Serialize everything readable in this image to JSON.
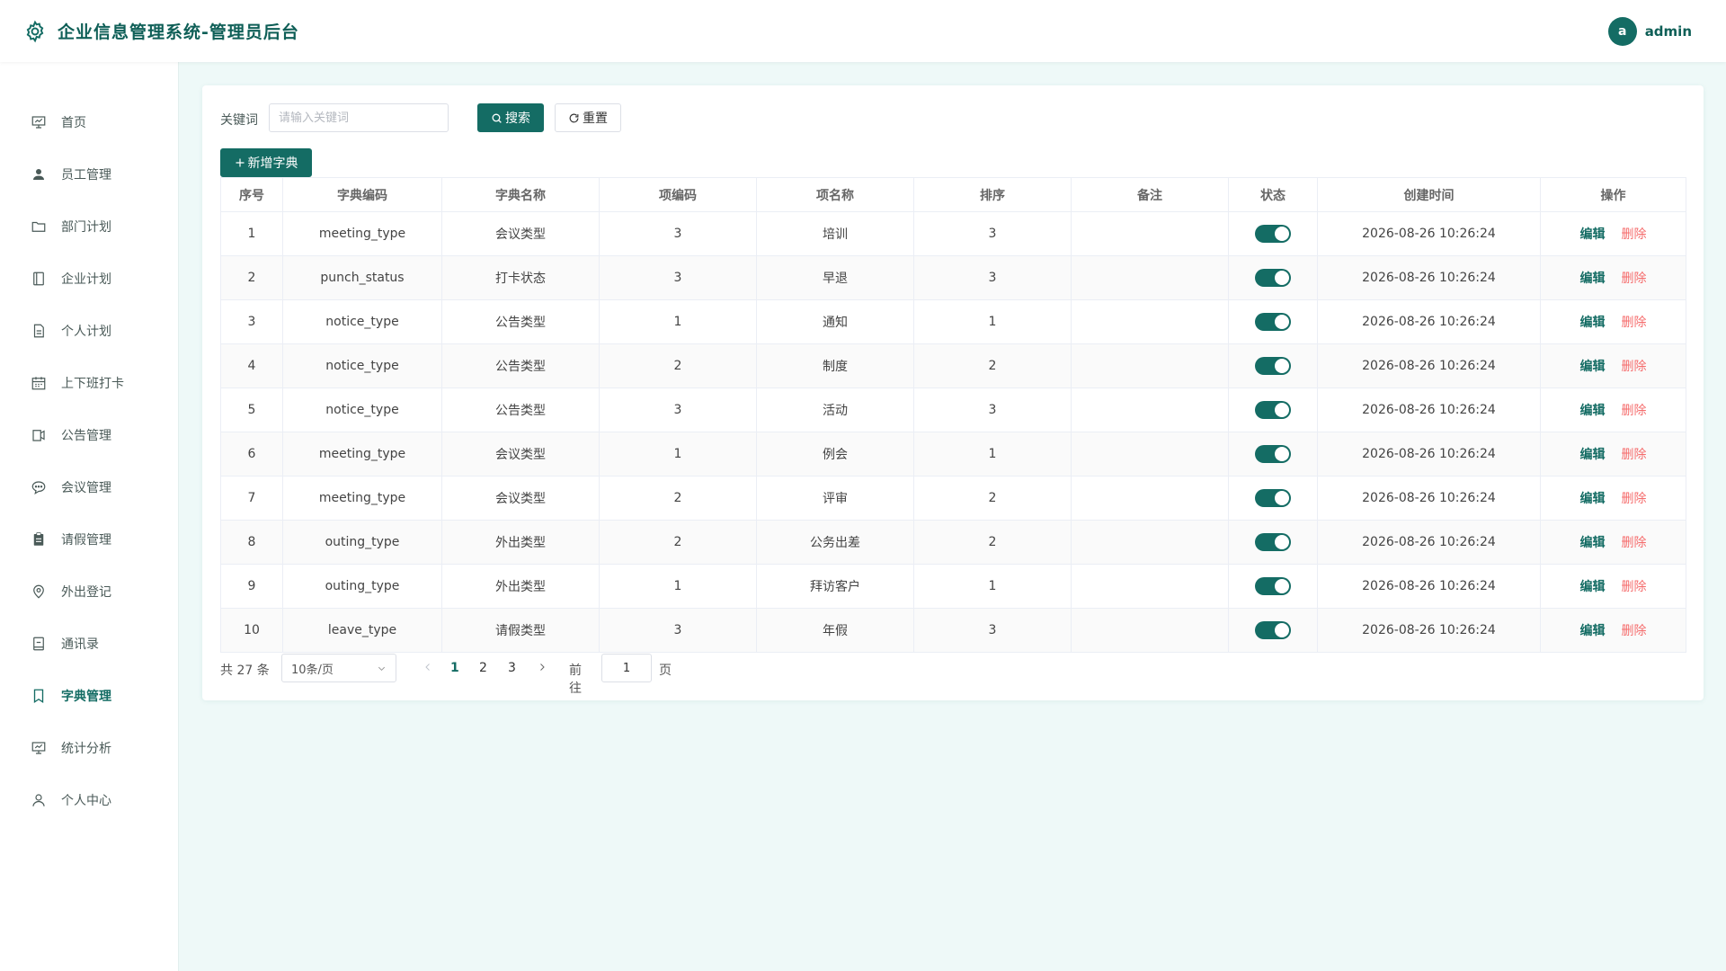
{
  "header": {
    "title": "企业信息管理系统-管理员后台",
    "logo_icon": "gear-icon",
    "avatar_letter": "a",
    "username": "admin"
  },
  "colors": {
    "primary": "#146c64",
    "danger": "#f56c6c",
    "background": "#eef9f8"
  },
  "sidebar": {
    "items": [
      {
        "label": "首页",
        "icon": "presentation-icon",
        "active": false
      },
      {
        "label": "员工管理",
        "icon": "user-icon",
        "active": false
      },
      {
        "label": "部门计划",
        "icon": "folder-icon",
        "active": false
      },
      {
        "label": "企业计划",
        "icon": "notebook-icon",
        "active": false
      },
      {
        "label": "个人计划",
        "icon": "document-icon",
        "active": false
      },
      {
        "label": "上下班打卡",
        "icon": "calendar-icon",
        "active": false
      },
      {
        "label": "公告管理",
        "icon": "notice-icon",
        "active": false
      },
      {
        "label": "会议管理",
        "icon": "chat-icon",
        "active": false
      },
      {
        "label": "请假管理",
        "icon": "clipboard-icon",
        "active": false
      },
      {
        "label": "外出登记",
        "icon": "location-icon",
        "active": false
      },
      {
        "label": "通讯录",
        "icon": "address-book-icon",
        "active": false
      },
      {
        "label": "字典管理",
        "icon": "bookmark-icon",
        "active": true
      },
      {
        "label": "统计分析",
        "icon": "chart-icon",
        "active": false
      },
      {
        "label": "个人中心",
        "icon": "person-icon",
        "active": false
      }
    ]
  },
  "search": {
    "label": "关键词",
    "placeholder": "请输入关键词",
    "value": "",
    "search_button": "搜索",
    "reset_button": "重置",
    "add_button": "新增字典"
  },
  "table": {
    "columns": [
      "序号",
      "字典编码",
      "字典名称",
      "项编码",
      "项名称",
      "排序",
      "备注",
      "状态",
      "创建时间",
      "操作"
    ],
    "edit_label": "编辑",
    "delete_label": "删除",
    "rows": [
      {
        "index": "1",
        "dict_code": "meeting_type",
        "dict_name": "会议类型",
        "item_code": "3",
        "item_name": "培训",
        "sort": "3",
        "remark": "",
        "status": true,
        "created": "2026-08-26 10:26:24"
      },
      {
        "index": "2",
        "dict_code": "punch_status",
        "dict_name": "打卡状态",
        "item_code": "3",
        "item_name": "早退",
        "sort": "3",
        "remark": "",
        "status": true,
        "created": "2026-08-26 10:26:24"
      },
      {
        "index": "3",
        "dict_code": "notice_type",
        "dict_name": "公告类型",
        "item_code": "1",
        "item_name": "通知",
        "sort": "1",
        "remark": "",
        "status": true,
        "created": "2026-08-26 10:26:24"
      },
      {
        "index": "4",
        "dict_code": "notice_type",
        "dict_name": "公告类型",
        "item_code": "2",
        "item_name": "制度",
        "sort": "2",
        "remark": "",
        "status": true,
        "created": "2026-08-26 10:26:24"
      },
      {
        "index": "5",
        "dict_code": "notice_type",
        "dict_name": "公告类型",
        "item_code": "3",
        "item_name": "活动",
        "sort": "3",
        "remark": "",
        "status": true,
        "created": "2026-08-26 10:26:24"
      },
      {
        "index": "6",
        "dict_code": "meeting_type",
        "dict_name": "会议类型",
        "item_code": "1",
        "item_name": "例会",
        "sort": "1",
        "remark": "",
        "status": true,
        "created": "2026-08-26 10:26:24"
      },
      {
        "index": "7",
        "dict_code": "meeting_type",
        "dict_name": "会议类型",
        "item_code": "2",
        "item_name": "评审",
        "sort": "2",
        "remark": "",
        "status": true,
        "created": "2026-08-26 10:26:24"
      },
      {
        "index": "8",
        "dict_code": "outing_type",
        "dict_name": "外出类型",
        "item_code": "2",
        "item_name": "公务出差",
        "sort": "2",
        "remark": "",
        "status": true,
        "created": "2026-08-26 10:26:24"
      },
      {
        "index": "9",
        "dict_code": "outing_type",
        "dict_name": "外出类型",
        "item_code": "1",
        "item_name": "拜访客户",
        "sort": "1",
        "remark": "",
        "status": true,
        "created": "2026-08-26 10:26:24"
      },
      {
        "index": "10",
        "dict_code": "leave_type",
        "dict_name": "请假类型",
        "item_code": "3",
        "item_name": "年假",
        "sort": "3",
        "remark": "",
        "status": true,
        "created": "2026-08-26 10:26:24"
      }
    ]
  },
  "pagination": {
    "total_text": "共 27 条",
    "page_size": "10条/页",
    "pages": [
      "1",
      "2",
      "3"
    ],
    "current_page": "1",
    "goto_label": "前往",
    "goto_value": "1",
    "page_unit": "页"
  }
}
